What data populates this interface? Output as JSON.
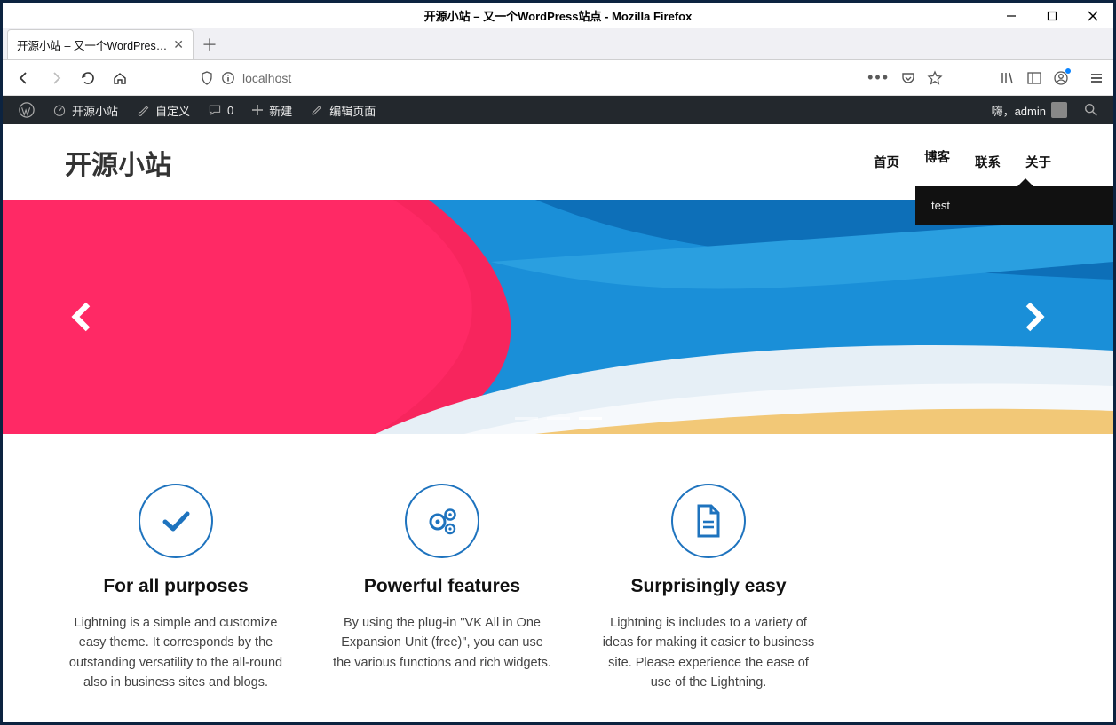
{
  "window": {
    "title": "开源小站 – 又一个WordPress站点 - Mozilla Firefox"
  },
  "tab": {
    "label": "开源小站 – 又一个WordPres…"
  },
  "url": {
    "text": "localhost"
  },
  "adminbar": {
    "site": "开源小站",
    "customize": "自定义",
    "comments": "0",
    "new": "新建",
    "edit": "编辑页面",
    "greeting": "嗨，admin"
  },
  "site": {
    "title": "开源小站",
    "nav": {
      "home": "首页",
      "blog": "博客",
      "contact": "联系",
      "about": "关于"
    },
    "dropdown": "test"
  },
  "features": [
    {
      "title": "For all purposes",
      "body": "Lightning is a simple and customize easy theme. It corresponds by the outstanding versatility to the all-round also in business sites and blogs."
    },
    {
      "title": "Powerful features",
      "body": "By using the plug-in \"VK All in One Expansion Unit (free)\", you can use the various functions and rich widgets."
    },
    {
      "title": "Surprisingly easy",
      "body": "Lightning is includes to a variety of ideas for making it easier to business site. Please experience the ease of use of the Lightning."
    }
  ]
}
